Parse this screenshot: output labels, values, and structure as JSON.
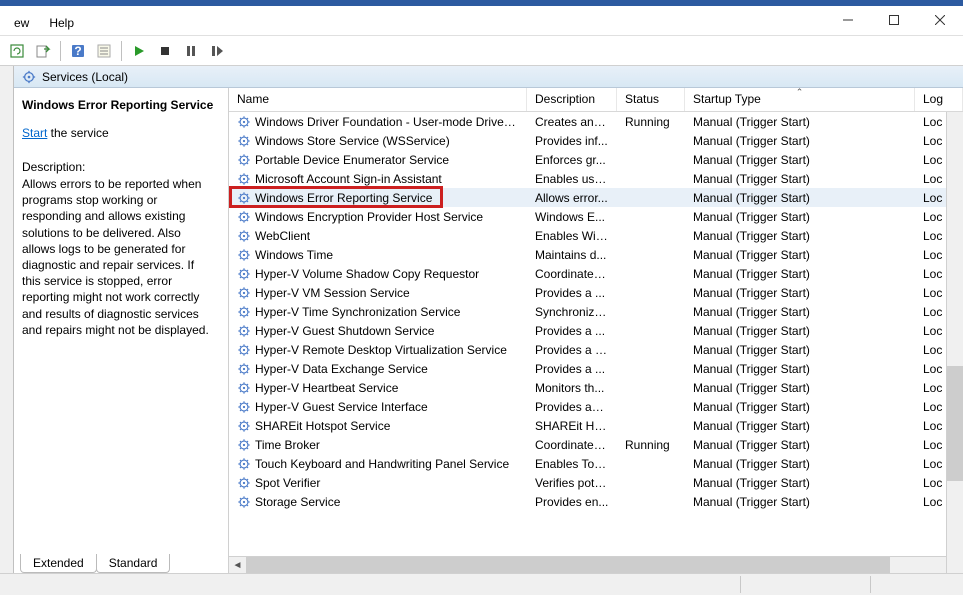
{
  "menubar": {
    "view": "ew",
    "help": "Help"
  },
  "tree": {
    "label": "Services (Local)"
  },
  "detail": {
    "title": "Windows Error Reporting Service",
    "start_label": "Start",
    "start_suffix": " the service",
    "description_label": "Description:",
    "description_text": "Allows errors to be reported when programs stop working or responding and allows existing solutions to be delivered. Also allows logs to be generated for diagnostic and repair services. If this service is stopped, error reporting might not work correctly and results of diagnostic services and repairs might not be displayed."
  },
  "columns": {
    "name": "Name",
    "description": "Description",
    "status": "Status",
    "startup": "Startup Type",
    "logon": "Log"
  },
  "rows": [
    {
      "name": "Windows Driver Foundation - User-mode Driver Fr...",
      "desc": "Creates and...",
      "status": "Running",
      "startup": "Manual (Trigger Start)",
      "logon": "Loc"
    },
    {
      "name": "Windows Store Service (WSService)",
      "desc": "Provides inf...",
      "status": "",
      "startup": "Manual (Trigger Start)",
      "logon": "Loc"
    },
    {
      "name": "Portable Device Enumerator Service",
      "desc": "Enforces gr...",
      "status": "",
      "startup": "Manual (Trigger Start)",
      "logon": "Loc"
    },
    {
      "name": "Microsoft Account Sign-in Assistant",
      "desc": "Enables use...",
      "status": "",
      "startup": "Manual (Trigger Start)",
      "logon": "Loc"
    },
    {
      "name": "Windows Error Reporting Service",
      "desc": "Allows error...",
      "status": "",
      "startup": "Manual (Trigger Start)",
      "logon": "Loc",
      "selected": true
    },
    {
      "name": "Windows Encryption Provider Host Service",
      "desc": "Windows E...",
      "status": "",
      "startup": "Manual (Trigger Start)",
      "logon": "Loc"
    },
    {
      "name": "WebClient",
      "desc": "Enables Win...",
      "status": "",
      "startup": "Manual (Trigger Start)",
      "logon": "Loc"
    },
    {
      "name": "Windows Time",
      "desc": "Maintains d...",
      "status": "",
      "startup": "Manual (Trigger Start)",
      "logon": "Loc"
    },
    {
      "name": "Hyper-V Volume Shadow Copy Requestor",
      "desc": "Coordinates...",
      "status": "",
      "startup": "Manual (Trigger Start)",
      "logon": "Loc"
    },
    {
      "name": "Hyper-V VM Session Service",
      "desc": "Provides a ...",
      "status": "",
      "startup": "Manual (Trigger Start)",
      "logon": "Loc"
    },
    {
      "name": "Hyper-V Time Synchronization Service",
      "desc": "Synchronize...",
      "status": "",
      "startup": "Manual (Trigger Start)",
      "logon": "Loc"
    },
    {
      "name": "Hyper-V Guest Shutdown Service",
      "desc": "Provides a ...",
      "status": "",
      "startup": "Manual (Trigger Start)",
      "logon": "Loc"
    },
    {
      "name": "Hyper-V Remote Desktop Virtualization Service",
      "desc": "Provides a p...",
      "status": "",
      "startup": "Manual (Trigger Start)",
      "logon": "Loc"
    },
    {
      "name": "Hyper-V Data Exchange Service",
      "desc": "Provides a ...",
      "status": "",
      "startup": "Manual (Trigger Start)",
      "logon": "Loc"
    },
    {
      "name": "Hyper-V Heartbeat Service",
      "desc": "Monitors th...",
      "status": "",
      "startup": "Manual (Trigger Start)",
      "logon": "Loc"
    },
    {
      "name": "Hyper-V Guest Service Interface",
      "desc": "Provides an ...",
      "status": "",
      "startup": "Manual (Trigger Start)",
      "logon": "Loc"
    },
    {
      "name": "SHAREit Hotspot Service",
      "desc": "SHAREit Ho...",
      "status": "",
      "startup": "Manual (Trigger Start)",
      "logon": "Loc"
    },
    {
      "name": "Time Broker",
      "desc": "Coordinates...",
      "status": "Running",
      "startup": "Manual (Trigger Start)",
      "logon": "Loc"
    },
    {
      "name": "Touch Keyboard and Handwriting Panel Service",
      "desc": "Enables Tou...",
      "status": "",
      "startup": "Manual (Trigger Start)",
      "logon": "Loc"
    },
    {
      "name": "Spot Verifier",
      "desc": "Verifies pote...",
      "status": "",
      "startup": "Manual (Trigger Start)",
      "logon": "Loc"
    },
    {
      "name": "Storage Service",
      "desc": "Provides en...",
      "status": "",
      "startup": "Manual (Trigger Start)",
      "logon": "Loc"
    }
  ],
  "tabs": {
    "extended": "Extended",
    "standard": "Standard"
  }
}
